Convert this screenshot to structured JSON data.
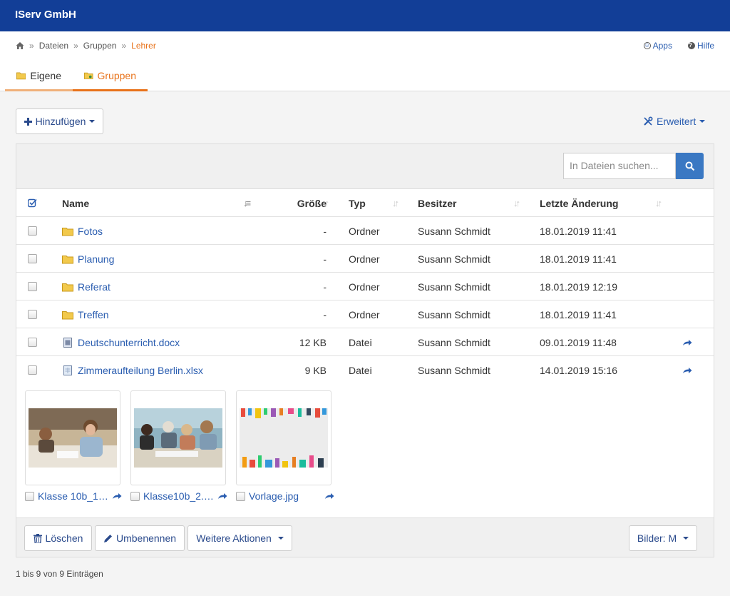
{
  "app": {
    "brand": "IServ GmbH"
  },
  "breadcrumb": {
    "items": [
      "Dateien",
      "Gruppen"
    ],
    "active": "Lehrer",
    "separator": "»"
  },
  "toplinks": {
    "apps": "Apps",
    "help": "Hilfe"
  },
  "tabs": [
    {
      "label": "Eigene"
    },
    {
      "label": "Gruppen"
    }
  ],
  "toolbar": {
    "add": "Hinzufügen",
    "advanced": "Erweitert"
  },
  "search": {
    "placeholder": "In Dateien suchen..."
  },
  "table": {
    "columns": {
      "name": "Name",
      "size": "Größe",
      "type": "Typ",
      "owner": "Besitzer",
      "modified": "Letzte Änderung"
    },
    "rows": [
      {
        "name": "Fotos",
        "size": "-",
        "type": "Ordner",
        "owner": "Susann Schmidt",
        "modified": "18.01.2019 11:41",
        "icon": "folder-icon"
      },
      {
        "name": "Planung",
        "size": "-",
        "type": "Ordner",
        "owner": "Susann Schmidt",
        "modified": "18.01.2019 11:41",
        "icon": "folder-icon"
      },
      {
        "name": "Referat",
        "size": "-",
        "type": "Ordner",
        "owner": "Susann Schmidt",
        "modified": "18.01.2019 12:19",
        "icon": "folder-icon"
      },
      {
        "name": "Treffen",
        "size": "-",
        "type": "Ordner",
        "owner": "Susann Schmidt",
        "modified": "18.01.2019 11:41",
        "icon": "folder-icon"
      },
      {
        "name": "Deutschunterricht.docx",
        "size": "12 KB",
        "type": "Datei",
        "owner": "Susann Schmidt",
        "modified": "09.01.2019 11:48",
        "icon": "document-icon"
      },
      {
        "name": "Zimmeraufteilung Berlin.xlsx",
        "size": "9 KB",
        "type": "Datei",
        "owner": "Susann Schmidt",
        "modified": "14.01.2019 15:16",
        "icon": "spreadsheet-icon"
      }
    ]
  },
  "gallery": [
    {
      "name": "Klasse 10b_1…"
    },
    {
      "name": "Klasse10b_2.…"
    },
    {
      "name": "Vorlage.jpg"
    }
  ],
  "footer": {
    "delete": "Löschen",
    "rename": "Umbenennen",
    "more": "Weitere Aktionen",
    "images": "Bilder: M"
  },
  "count": "1 bis 9 von 9 Einträgen",
  "colors": {
    "topbar": "#123e97",
    "accent": "#e8721a",
    "link": "#2a5db0",
    "search_button": "#3a78c3"
  }
}
